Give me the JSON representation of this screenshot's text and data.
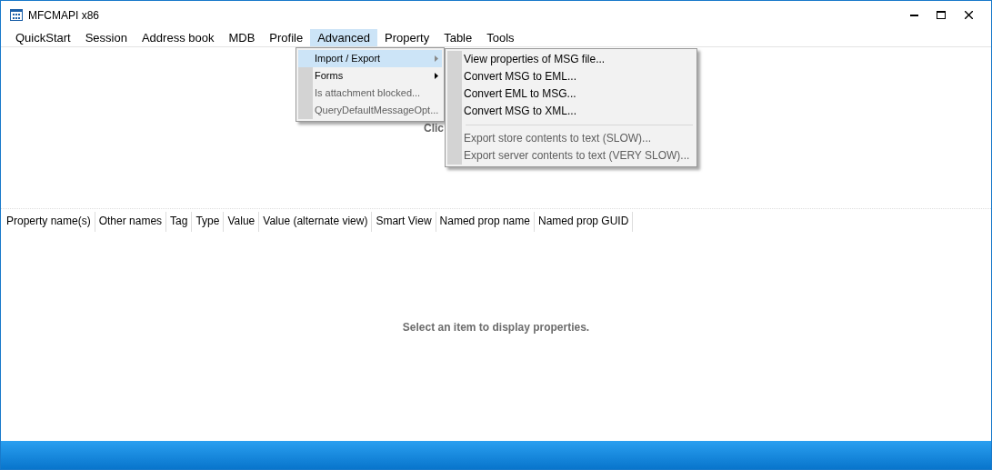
{
  "window": {
    "title": "MFCMAPI x86"
  },
  "menubar": [
    {
      "label": "QuickStart",
      "selected": false
    },
    {
      "label": "Session",
      "selected": false
    },
    {
      "label": "Address book",
      "selected": false
    },
    {
      "label": "MDB",
      "selected": false
    },
    {
      "label": "Profile",
      "selected": false
    },
    {
      "label": "Advanced",
      "selected": true
    },
    {
      "label": "Property",
      "selected": false
    },
    {
      "label": "Table",
      "selected": false
    },
    {
      "label": "Tools",
      "selected": false
    }
  ],
  "dropdown": [
    {
      "label": "Import / Export",
      "selected": true,
      "disabled": false,
      "submenu": true
    },
    {
      "label": "Forms",
      "selected": false,
      "disabled": false,
      "submenu": true
    },
    {
      "label": "Is attachment blocked...",
      "selected": false,
      "disabled": true,
      "submenu": false
    },
    {
      "label": "QueryDefaultMessageOpt...",
      "selected": false,
      "disabled": true,
      "submenu": false
    }
  ],
  "submenu": [
    {
      "kind": "item",
      "label": "View properties of MSG file...",
      "disabled": false
    },
    {
      "kind": "item",
      "label": "Convert MSG to EML...",
      "disabled": false
    },
    {
      "kind": "item",
      "label": "Convert EML to MSG...",
      "disabled": false
    },
    {
      "kind": "item",
      "label": "Convert MSG to XML...",
      "disabled": false
    },
    {
      "kind": "separator"
    },
    {
      "kind": "item",
      "label": "Export store contents to text (SLOW)...",
      "disabled": true
    },
    {
      "kind": "item",
      "label": "Export server contents to text (VERY SLOW)...",
      "disabled": true
    }
  ],
  "upper_pane": {
    "message": "Clic"
  },
  "table": {
    "columns": [
      "Property name(s)",
      "Other names",
      "Tag",
      "Type",
      "Value",
      "Value (alternate view)",
      "Smart View",
      "Named prop name",
      "Named prop GUID"
    ],
    "empty_message": "Select an item to display properties."
  }
}
